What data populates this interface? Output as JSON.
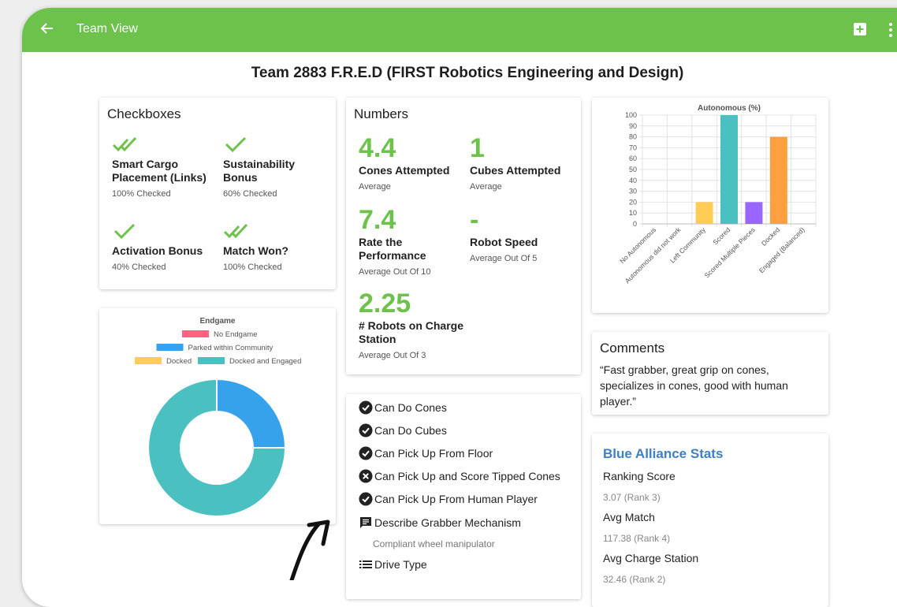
{
  "app": {
    "title": "Team View",
    "page_title": "Team 2883 F.R.E.D (FIRST Robotics Engineering and Design)",
    "accent": "#6cc24a"
  },
  "checkboxes": {
    "heading": "Checkboxes",
    "items": [
      {
        "label": "Smart Cargo Placement (Links)",
        "sub": "100% Checked",
        "icon": "double-check-icon"
      },
      {
        "label": "Sustainability Bonus",
        "sub": "60% Checked",
        "icon": "check-icon"
      },
      {
        "label": "Activation Bonus",
        "sub": "40% Checked",
        "icon": "check-icon"
      },
      {
        "label": "Match Won?",
        "sub": "100% Checked",
        "icon": "double-check-icon"
      }
    ]
  },
  "numbers": {
    "heading": "Numbers",
    "items": [
      {
        "value": "4.4",
        "label": "Cones Attempted",
        "sub": "Average"
      },
      {
        "value": "1",
        "label": "Cubes Attempted",
        "sub": "Average"
      },
      {
        "value": "7.4",
        "label": "Rate the Performance",
        "sub": "Average Out Of 10"
      },
      {
        "value": "-",
        "label": "Robot Speed",
        "sub": "Average Out Of 5"
      },
      {
        "value": "2.25",
        "label": "# Robots on Charge Station",
        "sub": "Average Out Of 3"
      }
    ]
  },
  "features": {
    "items": [
      {
        "label": "Can Do Cones",
        "icon": "check-circle-icon"
      },
      {
        "label": "Can Do Cubes",
        "icon": "check-circle-icon"
      },
      {
        "label": "Can Pick Up From Floor",
        "icon": "check-circle-icon"
      },
      {
        "label": "Can Pick Up and Score Tipped Cones",
        "icon": "x-circle-icon"
      },
      {
        "label": "Can Pick Up From Human Player",
        "icon": "check-circle-icon"
      },
      {
        "label": "Describe Grabber Mechanism",
        "icon": "comment-icon"
      },
      {
        "label": "Drive Type",
        "icon": "list-icon"
      }
    ],
    "grabber_answer": "Compliant wheel manipulator"
  },
  "comments": {
    "heading": "Comments",
    "text": "“Fast grabber, great grip on cones, specializes in cones, good with human player.”"
  },
  "blue_alliance": {
    "heading": "Blue Alliance Stats",
    "stats": [
      {
        "label": "Ranking Score",
        "value": "3.07 (Rank 3)"
      },
      {
        "label": "Avg Match",
        "value": "117.38 (Rank 4)"
      },
      {
        "label": "Avg Charge Station",
        "value": "32.46 (Rank 2)"
      }
    ]
  },
  "chart_data": [
    {
      "type": "bar",
      "title": "Autonomous (%)",
      "categories": [
        "No Autonomous",
        "Autonomous did not work",
        "Left Community",
        "Scored",
        "Scored Multiple Pieces",
        "Docked",
        "Engaged (Balanced)"
      ],
      "values": [
        0,
        0,
        20,
        100,
        20,
        80,
        0
      ],
      "colors": [
        "#ff6384",
        "#36a2eb",
        "#ffcd56",
        "#4bc0c0",
        "#9966ff",
        "#ff9f40",
        "#c9cbcf"
      ],
      "ylim": [
        0,
        100
      ],
      "yticks": [
        0,
        10,
        20,
        30,
        40,
        50,
        60,
        70,
        80,
        90,
        100
      ],
      "grid": true
    },
    {
      "type": "pie",
      "title": "Endgame",
      "labels": [
        "No Endgame",
        "Parked within Community",
        "Docked",
        "Docked and Engaged"
      ],
      "values": [
        0,
        25,
        0,
        75
      ],
      "colors": [
        "#ff6384",
        "#36a2eb",
        "#ffcd56",
        "#4bc0c0"
      ],
      "legend": "top"
    }
  ]
}
